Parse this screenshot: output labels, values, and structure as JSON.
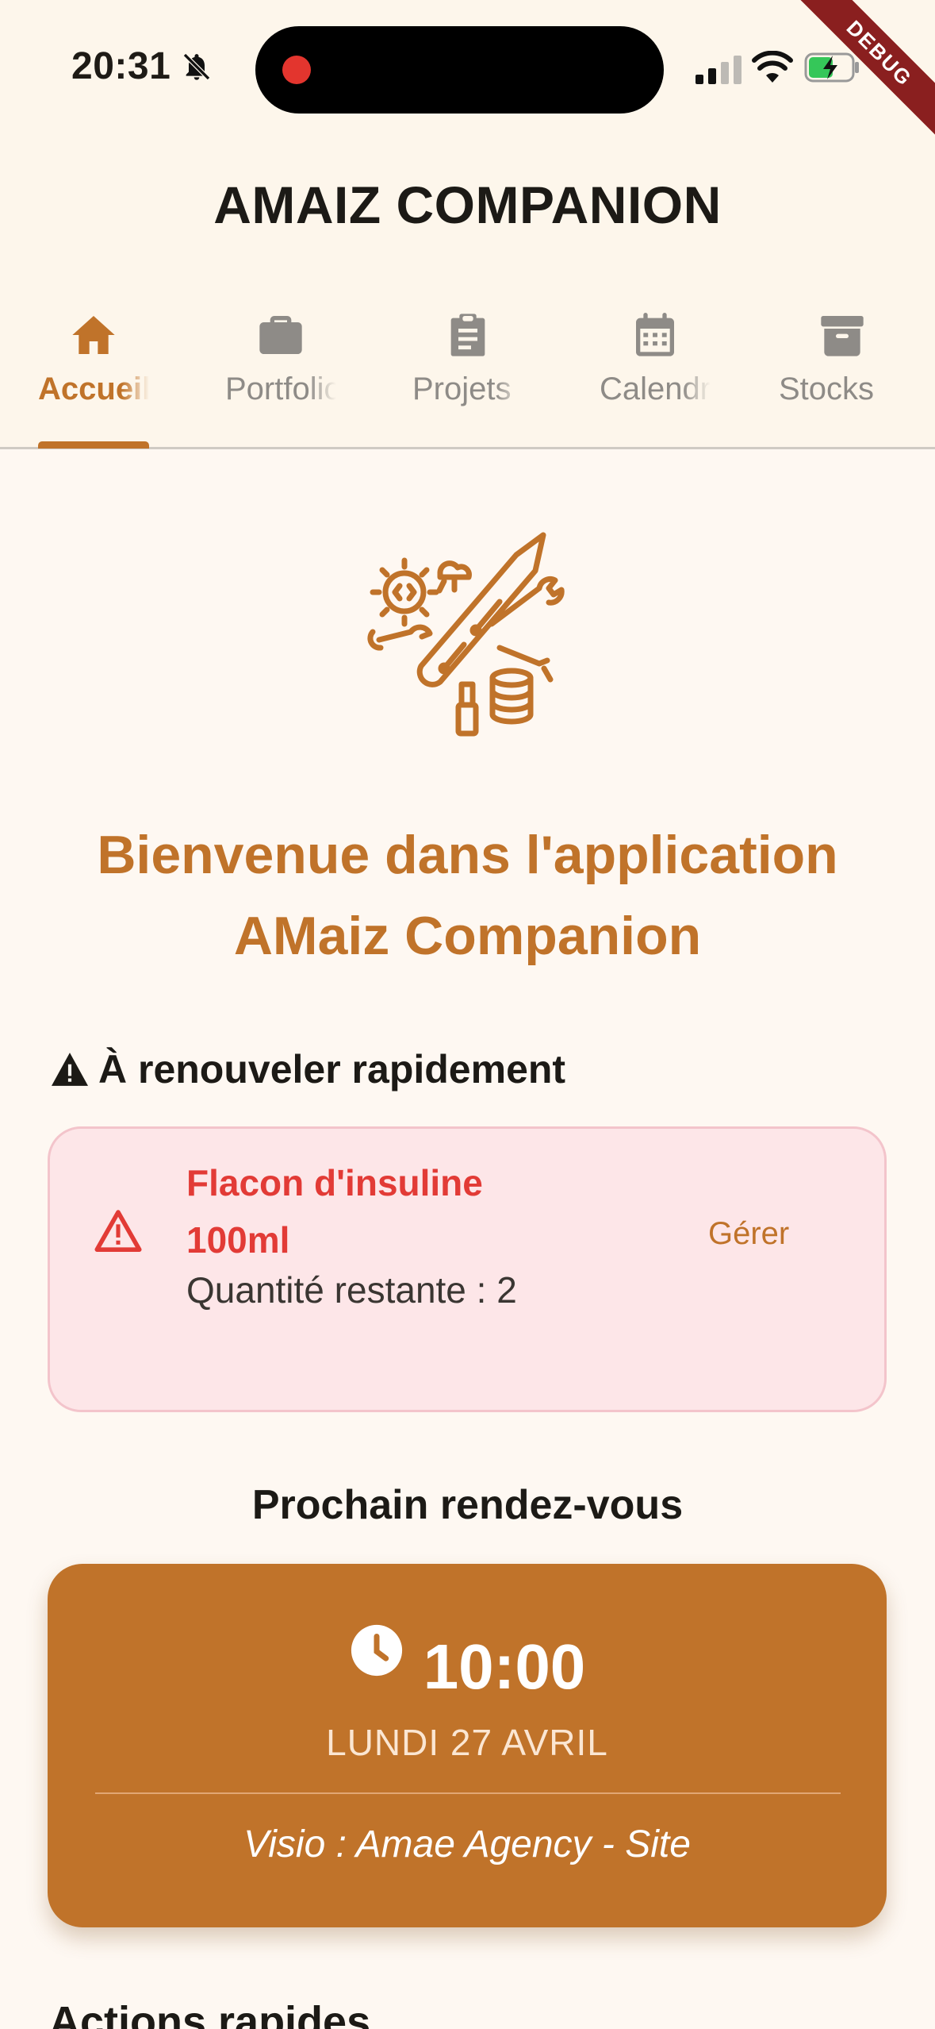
{
  "status_bar": {
    "time": "20:31",
    "debug_label": "DEBUG"
  },
  "app_bar": {
    "title": "AMAIZ COMPANION"
  },
  "tabs": [
    {
      "label": "Accueil",
      "icon": "home-icon",
      "active": true
    },
    {
      "label": "Portfolio",
      "icon": "briefcase-icon",
      "active": false
    },
    {
      "label": "Projets",
      "icon": "clipboard-icon",
      "active": false
    },
    {
      "label": "Calendrier",
      "icon": "calendar-icon",
      "active": false
    },
    {
      "label": "Stocks",
      "icon": "archive-icon",
      "active": false
    }
  ],
  "home": {
    "welcome": "Bienvenue dans l'application AMaiz Companion",
    "renew_section": {
      "title": "À renouveler rapidement",
      "items": [
        {
          "name": "Flacon d'insuline 100ml",
          "quantity": "Quantité restante : 2",
          "action": "Gérer"
        }
      ]
    },
    "next_appointment": {
      "title": "Prochain rendez-vous",
      "time": "10:00",
      "date": "LUNDI 27 AVRIL",
      "description": "Visio : Amae Agency - Site"
    },
    "quick_actions_title": "Actions rapides"
  },
  "colors": {
    "accent": "#C0732A",
    "background": "#FDF6EB",
    "alert_bg": "#FDE6E8",
    "alert_text": "#E23B36"
  }
}
